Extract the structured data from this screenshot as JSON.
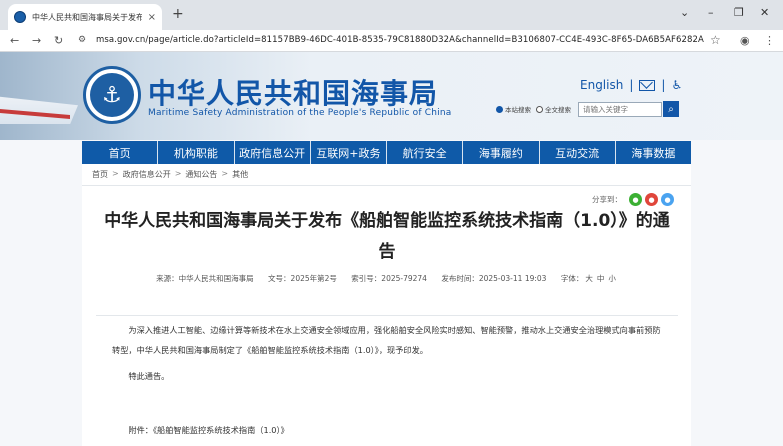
{
  "browser": {
    "tab_title": "中华人民共和国海事局关于发布...",
    "tab_close": "×",
    "new_tab": "+",
    "url": "msa.gov.cn/page/article.do?articleId=81157BB9-46DC-401B-8535-79C81880D32A&channelId=B3106807-CC4E-493C-8F65-DA6B5AF6282A",
    "win_min": "⌄",
    "win_minimize": "–",
    "win_max": "❐",
    "win_close": "✕"
  },
  "header": {
    "site_title": "中华人民共和国海事局",
    "site_subtitle": "Maritime Safety Administration of the People's Republic of China",
    "emblem_text": "CHINA MSA",
    "english_link": "English",
    "radio_site": "本站搜索",
    "radio_all": "全文搜索",
    "search_placeholder": "请输入关键字"
  },
  "nav": {
    "items": [
      "首页",
      "机构职能",
      "政府信息公开",
      "互联网+政务",
      "航行安全",
      "海事履约",
      "互动交流",
      "海事数据"
    ]
  },
  "breadcrumb": [
    "首页",
    "政府信息公开",
    "通知公告",
    "其他"
  ],
  "share": {
    "label": "分享到："
  },
  "article": {
    "title": "中华人民共和国海事局关于发布《船舶智能监控系统技术指南（1.0）》的通告",
    "source_label": "来源：",
    "source": "中华人民共和国海事局",
    "doc_no_label": "文号：",
    "doc_no": "2025年第2号",
    "index_label": "索引号：",
    "index_no": "2025-79274",
    "date_label": "发布时间：",
    "date": "2025-03-11 19:03",
    "font_label": "字体：",
    "font_big": "大",
    "font_mid": "中",
    "font_small": "小",
    "para1": "为深入推进人工智能、边缘计算等新技术在水上交通安全领域应用，强化船舶安全风险实时感知、智能预警，推动水上交通安全治理模式向事前预防转型，中华人民共和国海事局制定了《船舶智能监控系统技术指南（1.0）》，现予印发。",
    "para2": "特此通告。",
    "attachment": "附件：《船舶智能监控系统技术指南（1.0）》"
  },
  "colors": {
    "brand_blue": "#1256a8",
    "nav_blue": "#0f5aa8",
    "wechat_green": "#3cb034",
    "weibo_red": "#e0463b",
    "qq_blue": "#4aa3f0"
  }
}
